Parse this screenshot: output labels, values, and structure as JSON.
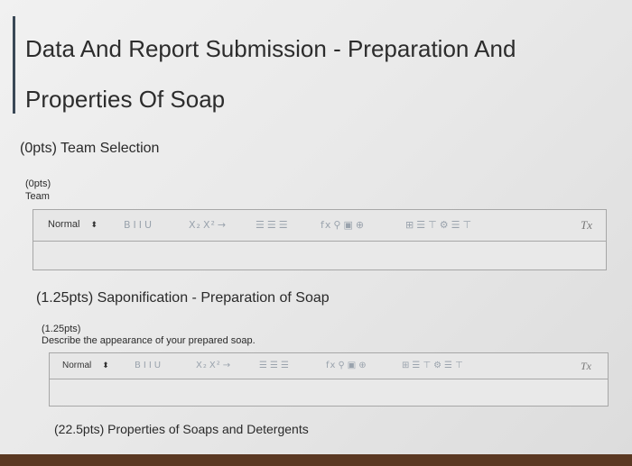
{
  "page": {
    "title": "Data And Report Submission - Preparation And Properties Of Soap"
  },
  "sections": [
    {
      "heading": "(0pts) Team Selection",
      "question": {
        "points": "(0pts)",
        "prompt": "Team"
      }
    },
    {
      "heading": "(1.25pts) Saponification - Preparation of Soap",
      "question": {
        "points": "(1.25pts)",
        "prompt": "Describe the appearance of your prepared soap."
      }
    },
    {
      "heading": "(22.5pts) Properties of Soaps and Detergents"
    }
  ],
  "toolbar": {
    "style_value": "Normal",
    "style_arrow": "⬍",
    "text_format": [
      "B",
      "I",
      "I",
      "U"
    ],
    "script": [
      "X₂",
      "X²",
      "→"
    ],
    "align": [
      "☰",
      "☰",
      "☰"
    ],
    "insert": [
      "fx",
      "⚲",
      "▣",
      "⊕"
    ],
    "table": [
      "⊞",
      "☰",
      "⊤",
      "⚙",
      "☰",
      "⊤"
    ],
    "clear": "Tx"
  },
  "colors": {
    "accent": "#3a4856",
    "bottom_strip": "#5a3822"
  }
}
